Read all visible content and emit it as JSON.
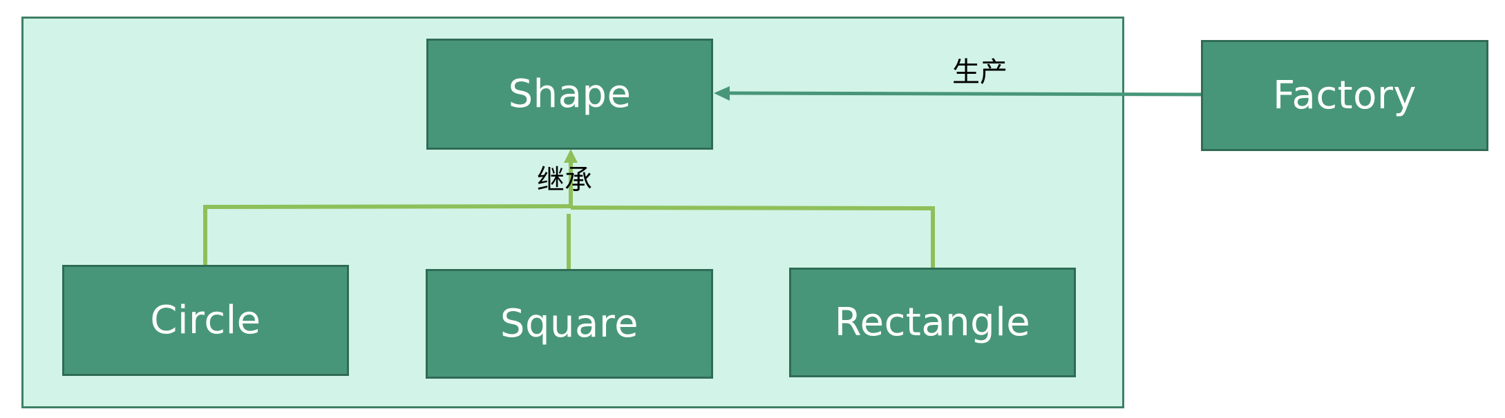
{
  "nodes": {
    "shape": "Shape",
    "factory": "Factory",
    "circle": "Circle",
    "square": "Square",
    "rectangle": "Rectangle"
  },
  "edges": {
    "produce": "生产",
    "inherit": "继承"
  },
  "colors": {
    "container_fill": "#d2f3e7",
    "container_border": "#3d7f66",
    "node_fill": "#48967a",
    "node_border": "#2f6b55",
    "inherit_line": "#8dc05a",
    "produce_line": "#48967a"
  }
}
